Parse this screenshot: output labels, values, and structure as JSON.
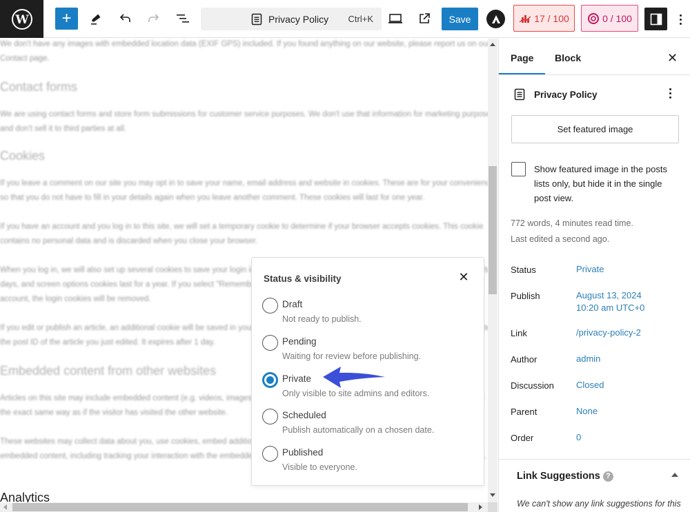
{
  "toolbar": {
    "add_label": "+",
    "document_title": "Privacy Policy",
    "shortcut": "Ctrl+K",
    "save_label": "Save",
    "seo_score": "17 / 100",
    "readability_score": "0 / 100",
    "colors": {
      "accent": "#1a7ec4",
      "seo": "#d63638",
      "readability": "#c2185b"
    }
  },
  "editor": {
    "paragraphs": [
      "We don't have any images with embedded location data (EXIF GPS) included. If you found anything on our website, please report us on our Contact page.",
      "We are using contact forms and store form submissions for customer service purposes. We don't use that information for marketing purposes and don't sell it to third parties at all.",
      "If you leave a comment on our site you may opt in to save your name, email address and website in cookies. These are for your convenience so that you do not have to fill in your details again when you leave another comment. These cookies will last for one year.",
      "If you have an account and you log in to this site, we will set a temporary cookie to determine if your browser accepts cookies. This cookie contains no personal data and is discarded when you close your browser.",
      "When you log in, we will also set up several cookies to save your login information and your screen display choices. Login cookies last for two days, and screen options cookies last for a year. If you select \"Remember Me\", your login will persist for two weeks. If you log out of your account, the login cookies will be removed.",
      "If you edit or publish an article, an additional cookie will be saved in your browser. This cookie includes no personal data and simply indicates the post ID of the article you just edited. It expires after 1 day.",
      "Articles on this site may include embedded content (e.g. videos, images, articles, etc.). Embedded content from other websites behaves in the exact same way as if the visitor has visited the other website.",
      "These websites may collect data about you, use cookies, embed additional third-party tracking, and monitor your interaction with that embedded content, including tracking your interaction with the embedded content if you have an account and are logged in to that website."
    ],
    "headings": [
      "Contact forms",
      "Cookies",
      "Embedded content from other websites",
      "Analytics"
    ],
    "contact_link": "Contact"
  },
  "status_popover": {
    "title": "Status & visibility",
    "options": [
      {
        "label": "Draft",
        "description": "Not ready to publish.",
        "checked": false
      },
      {
        "label": "Pending",
        "description": "Waiting for review before publishing.",
        "checked": false
      },
      {
        "label": "Private",
        "description": "Only visible to site admins and editors.",
        "checked": true
      },
      {
        "label": "Scheduled",
        "description": "Publish automatically on a chosen date.",
        "checked": false
      },
      {
        "label": "Published",
        "description": "Visible to everyone.",
        "checked": false
      }
    ]
  },
  "sidebar": {
    "tabs": [
      {
        "label": "Page",
        "active": true
      },
      {
        "label": "Block",
        "active": false
      }
    ],
    "doc_title": "Privacy Policy",
    "featured_image_button": "Set featured image",
    "hide_featured_label": "Show featured image in the posts lists only, but hide it in the single post view.",
    "word_count": "772 words, 4 minutes read time.",
    "last_edited": "Last edited a second ago.",
    "rows": [
      {
        "label": "Status",
        "value": "Private"
      },
      {
        "label": "Publish",
        "value": "August 13, 2024",
        "value2": "10:20 am UTC+0"
      },
      {
        "label": "Link",
        "value": "/privacy-policy-2"
      },
      {
        "label": "Author",
        "value": "admin"
      },
      {
        "label": "Discussion",
        "value": "Closed"
      },
      {
        "label": "Parent",
        "value": "None"
      },
      {
        "label": "Order",
        "value": "0"
      }
    ],
    "link_suggestions": {
      "title": "Link Suggestions",
      "help": "?",
      "message": "We can't show any link suggestions for this"
    }
  }
}
